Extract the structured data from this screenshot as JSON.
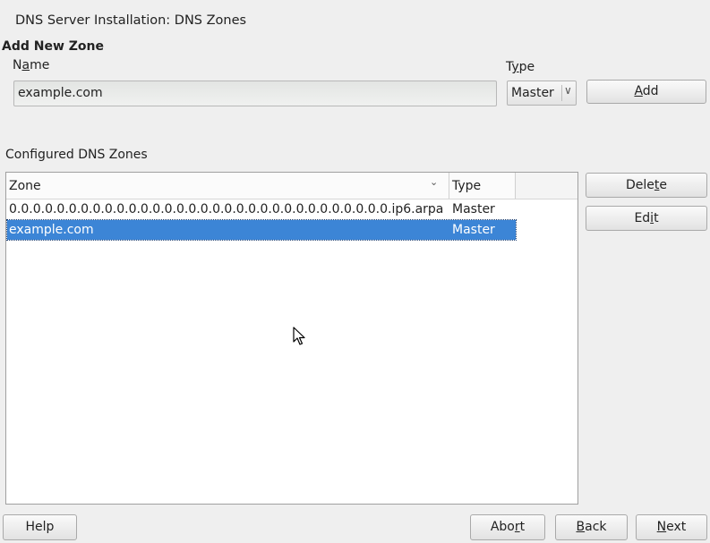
{
  "window": {
    "title": "DNS Server Installation: DNS Zones"
  },
  "add_zone": {
    "heading": "Add New Zone",
    "name_label_prefix": "N",
    "name_label_mnemonic": "a",
    "name_label_suffix": "me",
    "name_value": "example.com",
    "type_label_prefix": "T",
    "type_label_mnemonic": "y",
    "type_label_suffix": "pe",
    "type_value": "Master",
    "add_prefix": "",
    "add_mnemonic": "A",
    "add_suffix": "dd"
  },
  "zones": {
    "heading": "Configured DNS Zones",
    "columns": [
      "Zone",
      "Type"
    ],
    "rows": [
      {
        "zone": "0.0.0.0.0.0.0.0.0.0.0.0.0.0.0.0.0.0.0.0.0.0.0.0.0.0.0.0.0.0.0.0.ip6.arpa",
        "type": "Master",
        "selected": false
      },
      {
        "zone": "example.com",
        "type": "Master",
        "selected": true
      }
    ],
    "delete_prefix": "Dele",
    "delete_mnemonic": "t",
    "delete_suffix": "e",
    "edit_prefix": "Ed",
    "edit_mnemonic": "i",
    "edit_suffix": "t"
  },
  "footer": {
    "help": "Help",
    "abort_prefix": "Abo",
    "abort_mnemonic": "r",
    "abort_suffix": "t",
    "back_prefix": "",
    "back_mnemonic": "B",
    "back_suffix": "ack",
    "next_prefix": "",
    "next_mnemonic": "N",
    "next_suffix": "ext"
  },
  "colors": {
    "selection": "#3c85d6",
    "background": "#efefef"
  },
  "icons": {
    "combo_arrow": "chevron-down-icon",
    "sort_indicator": "sort-arrow-icon",
    "pointer": "mouse-cursor-icon"
  }
}
